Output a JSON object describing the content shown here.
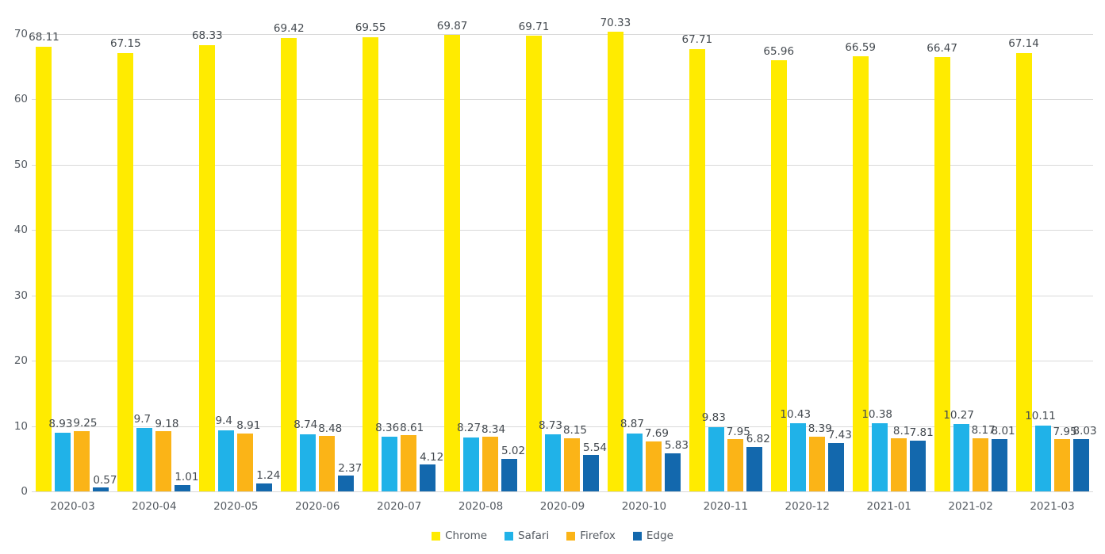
{
  "chart_data": {
    "type": "bar",
    "title": "",
    "subtitle": "",
    "xlabel": "",
    "ylabel": "",
    "ylim": [
      0,
      70
    ],
    "yticks": [
      0,
      10,
      20,
      30,
      40,
      50,
      60,
      70
    ],
    "ytick_labels": [
      "0",
      "10",
      "20",
      "30",
      "40",
      "50",
      "60",
      "70"
    ],
    "grid": true,
    "legend_position": "bottom",
    "bar_labels_shown": true,
    "categories": [
      "2020-03",
      "2020-04",
      "2020-05",
      "2020-06",
      "2020-07",
      "2020-08",
      "2020-09",
      "2020-10",
      "2020-11",
      "2020-12",
      "2021-01",
      "2021-02",
      "2021-03"
    ],
    "series": [
      {
        "name": "Chrome",
        "color": "#ffeb00",
        "values": [
          68.11,
          67.15,
          68.33,
          69.42,
          69.55,
          69.87,
          69.71,
          70.33,
          67.71,
          65.96,
          66.59,
          66.47,
          67.14
        ],
        "labels": [
          "68.11",
          "67.15",
          "68.33",
          "69.42",
          "69.55",
          "69.87",
          "69.71",
          "70.33",
          "67.71",
          "65.96",
          "66.59",
          "66.47",
          "67.14"
        ]
      },
      {
        "name": "Safari",
        "color": "#20b2e8",
        "values": [
          8.93,
          9.7,
          9.4,
          8.74,
          8.36,
          8.27,
          8.73,
          8.87,
          9.83,
          10.43,
          10.38,
          10.27,
          10.11
        ],
        "labels": [
          "8.93",
          "9.7",
          "9.4",
          "8.74",
          "8.36",
          "8.27",
          "8.73",
          "8.87",
          "9.83",
          "10.43",
          "10.38",
          "10.27",
          "10.11"
        ]
      },
      {
        "name": "Firefox",
        "color": "#fbb417",
        "values": [
          9.25,
          9.18,
          8.91,
          8.48,
          8.61,
          8.34,
          8.15,
          7.69,
          7.95,
          8.39,
          8.1,
          8.17,
          7.95
        ],
        "labels": [
          "9.25",
          "9.18",
          "8.91",
          "8.48",
          "8.61",
          "8.34",
          "8.15",
          "7.69",
          "7.95",
          "8.39",
          "8.1",
          "8.17",
          "7.95"
        ]
      },
      {
        "name": "Edge",
        "color": "#1368ad",
        "values": [
          0.57,
          1.01,
          1.24,
          2.37,
          4.12,
          5.02,
          5.54,
          5.83,
          6.82,
          7.43,
          7.81,
          8.01,
          8.03
        ],
        "labels": [
          "0.57",
          "1.01",
          "1.24",
          "2.37",
          "4.12",
          "5.02",
          "5.54",
          "5.83",
          "6.82",
          "7.43",
          "7.81",
          "8.01",
          "8.03"
        ]
      }
    ]
  },
  "legend": {
    "items": [
      {
        "label": "Chrome",
        "color": "#ffeb00"
      },
      {
        "label": "Safari",
        "color": "#20b2e8"
      },
      {
        "label": "Firefox",
        "color": "#fbb417"
      },
      {
        "label": "Edge",
        "color": "#1368ad"
      }
    ]
  }
}
